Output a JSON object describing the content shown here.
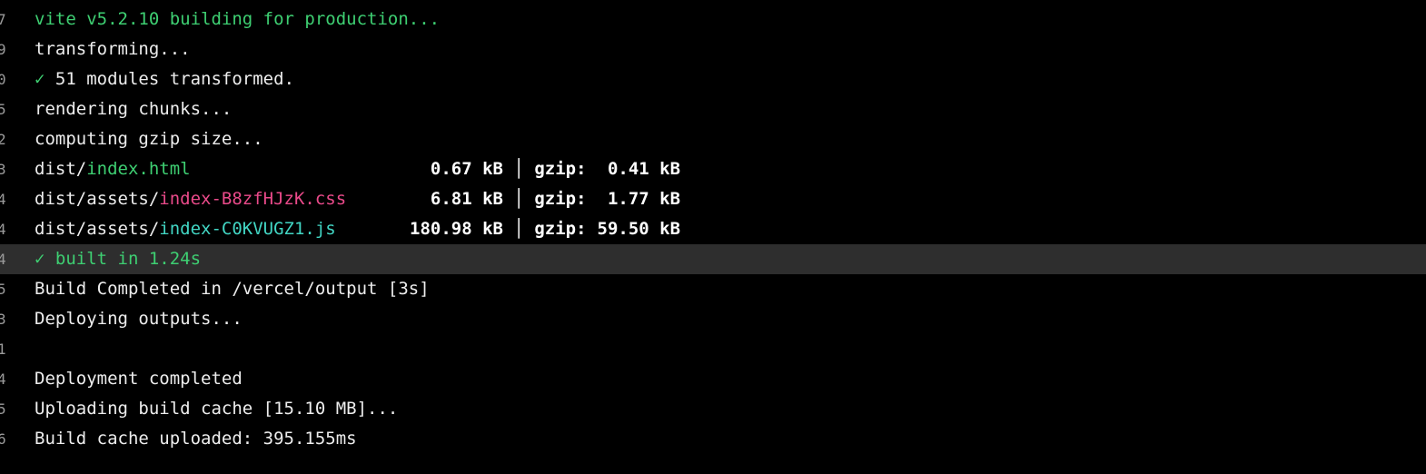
{
  "colors": {
    "background": "#000000",
    "text": "#ededed",
    "success_green": "#3ecf72",
    "css_pink": "#ea4a8a",
    "js_cyan": "#42d6c4",
    "highlight_row": "#2e2e2e"
  },
  "gutter": {
    "digits": [
      "7",
      "9",
      "0",
      "5",
      "2",
      "3",
      "4",
      "4",
      "4",
      "5",
      "3",
      "1",
      "4",
      "5",
      "6"
    ]
  },
  "log": {
    "vite_header": "vite v5.2.10 building for production...",
    "transforming": "transforming...",
    "check_icon": "✓",
    "modules_transformed": "51 modules transformed.",
    "rendering": "rendering chunks...",
    "computing": "computing gzip size...",
    "assets": [
      {
        "prefix": "dist/",
        "file": "index.html",
        "size": "0.67 kB",
        "sep": "│",
        "gzip_label": "gzip:",
        "gzip_size": "0.41 kB"
      },
      {
        "prefix": "dist/assets/",
        "file": "index-B8zfHJzK.css",
        "size": "6.81 kB",
        "sep": "│",
        "gzip_label": "gzip:",
        "gzip_size": "1.77 kB"
      },
      {
        "prefix": "dist/assets/",
        "file": "index-C0KVUGZ1.js",
        "size": "180.98 kB",
        "sep": "│",
        "gzip_label": "gzip:",
        "gzip_size": "59.50 kB"
      }
    ],
    "built_in": "built in 1.24s",
    "build_completed": "Build Completed in /vercel/output [3s]",
    "deploying": "Deploying outputs...",
    "deployment_completed": "Deployment completed",
    "uploading_cache": "Uploading build cache [15.10 MB]...",
    "cache_uploaded": "Build cache uploaded: 395.155ms"
  }
}
